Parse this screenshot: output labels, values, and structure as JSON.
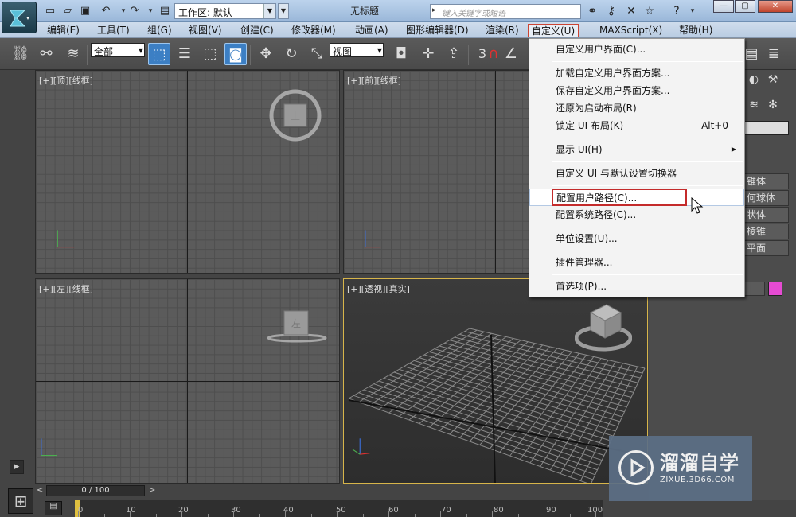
{
  "title_bar": {
    "workspace_label": "工作区: 默认",
    "window_title": "无标题",
    "search_placeholder": "键入关键字或短语"
  },
  "menu_bar": {
    "items": [
      {
        "label": "编辑(E)"
      },
      {
        "label": "工具(T)"
      },
      {
        "label": "组(G)"
      },
      {
        "label": "视图(V)"
      },
      {
        "label": "创建(C)"
      },
      {
        "label": "修改器(M)"
      },
      {
        "label": "动画(A)"
      },
      {
        "label": "图形编辑器(D)"
      },
      {
        "label": "渲染(R)"
      },
      {
        "label": "自定义(U)",
        "active": true
      },
      {
        "label": "MAXScript(X)"
      },
      {
        "label": "帮助(H)"
      }
    ]
  },
  "toolbar": {
    "selection_filter": "全部",
    "reference_coord": "视图",
    "snap_label": "3"
  },
  "customize_menu": {
    "items": [
      {
        "label": "自定义用户界面(C)..."
      },
      {
        "label": "加载自定义用户界面方案..."
      },
      {
        "label": "保存自定义用户界面方案..."
      },
      {
        "label": "还原为启动布局(R)"
      },
      {
        "label": "锁定 UI 布局(K)",
        "shortcut": "Alt+0"
      },
      {
        "label": "显示 UI(H)",
        "submenu": true
      },
      {
        "label": "自定义 UI 与默认设置切换器"
      },
      {
        "label": "配置用户路径(C)...",
        "highlighted": true
      },
      {
        "label": "配置系统路径(C)..."
      },
      {
        "label": "单位设置(U)..."
      },
      {
        "label": "插件管理器..."
      },
      {
        "label": "首选项(P)..."
      }
    ]
  },
  "viewports": {
    "top": "[+][顶][线框]",
    "front": "[+][前][线框]",
    "left": "[+][左][线框]",
    "perspective": "[+][透视][真实]",
    "cube_top_face": "上",
    "cube_left_face": "左"
  },
  "command_panel": {
    "rows": [
      "锥体",
      "何球体",
      "状体",
      "棱锥",
      "平面"
    ]
  },
  "timeline": {
    "slider_text": "0 / 100",
    "ticks": [
      "0",
      "10",
      "20",
      "30",
      "40",
      "50",
      "60",
      "70",
      "80",
      "90",
      "100"
    ]
  },
  "watermark": {
    "title": "溜溜自学",
    "url": "ZIXUE.3D66.COM"
  },
  "colors": {
    "selection_blue": "#3c7fc4",
    "highlight_red": "#c42b2b",
    "active_viewport": "#d7b54a",
    "color_swatch": "#e64bd3"
  }
}
